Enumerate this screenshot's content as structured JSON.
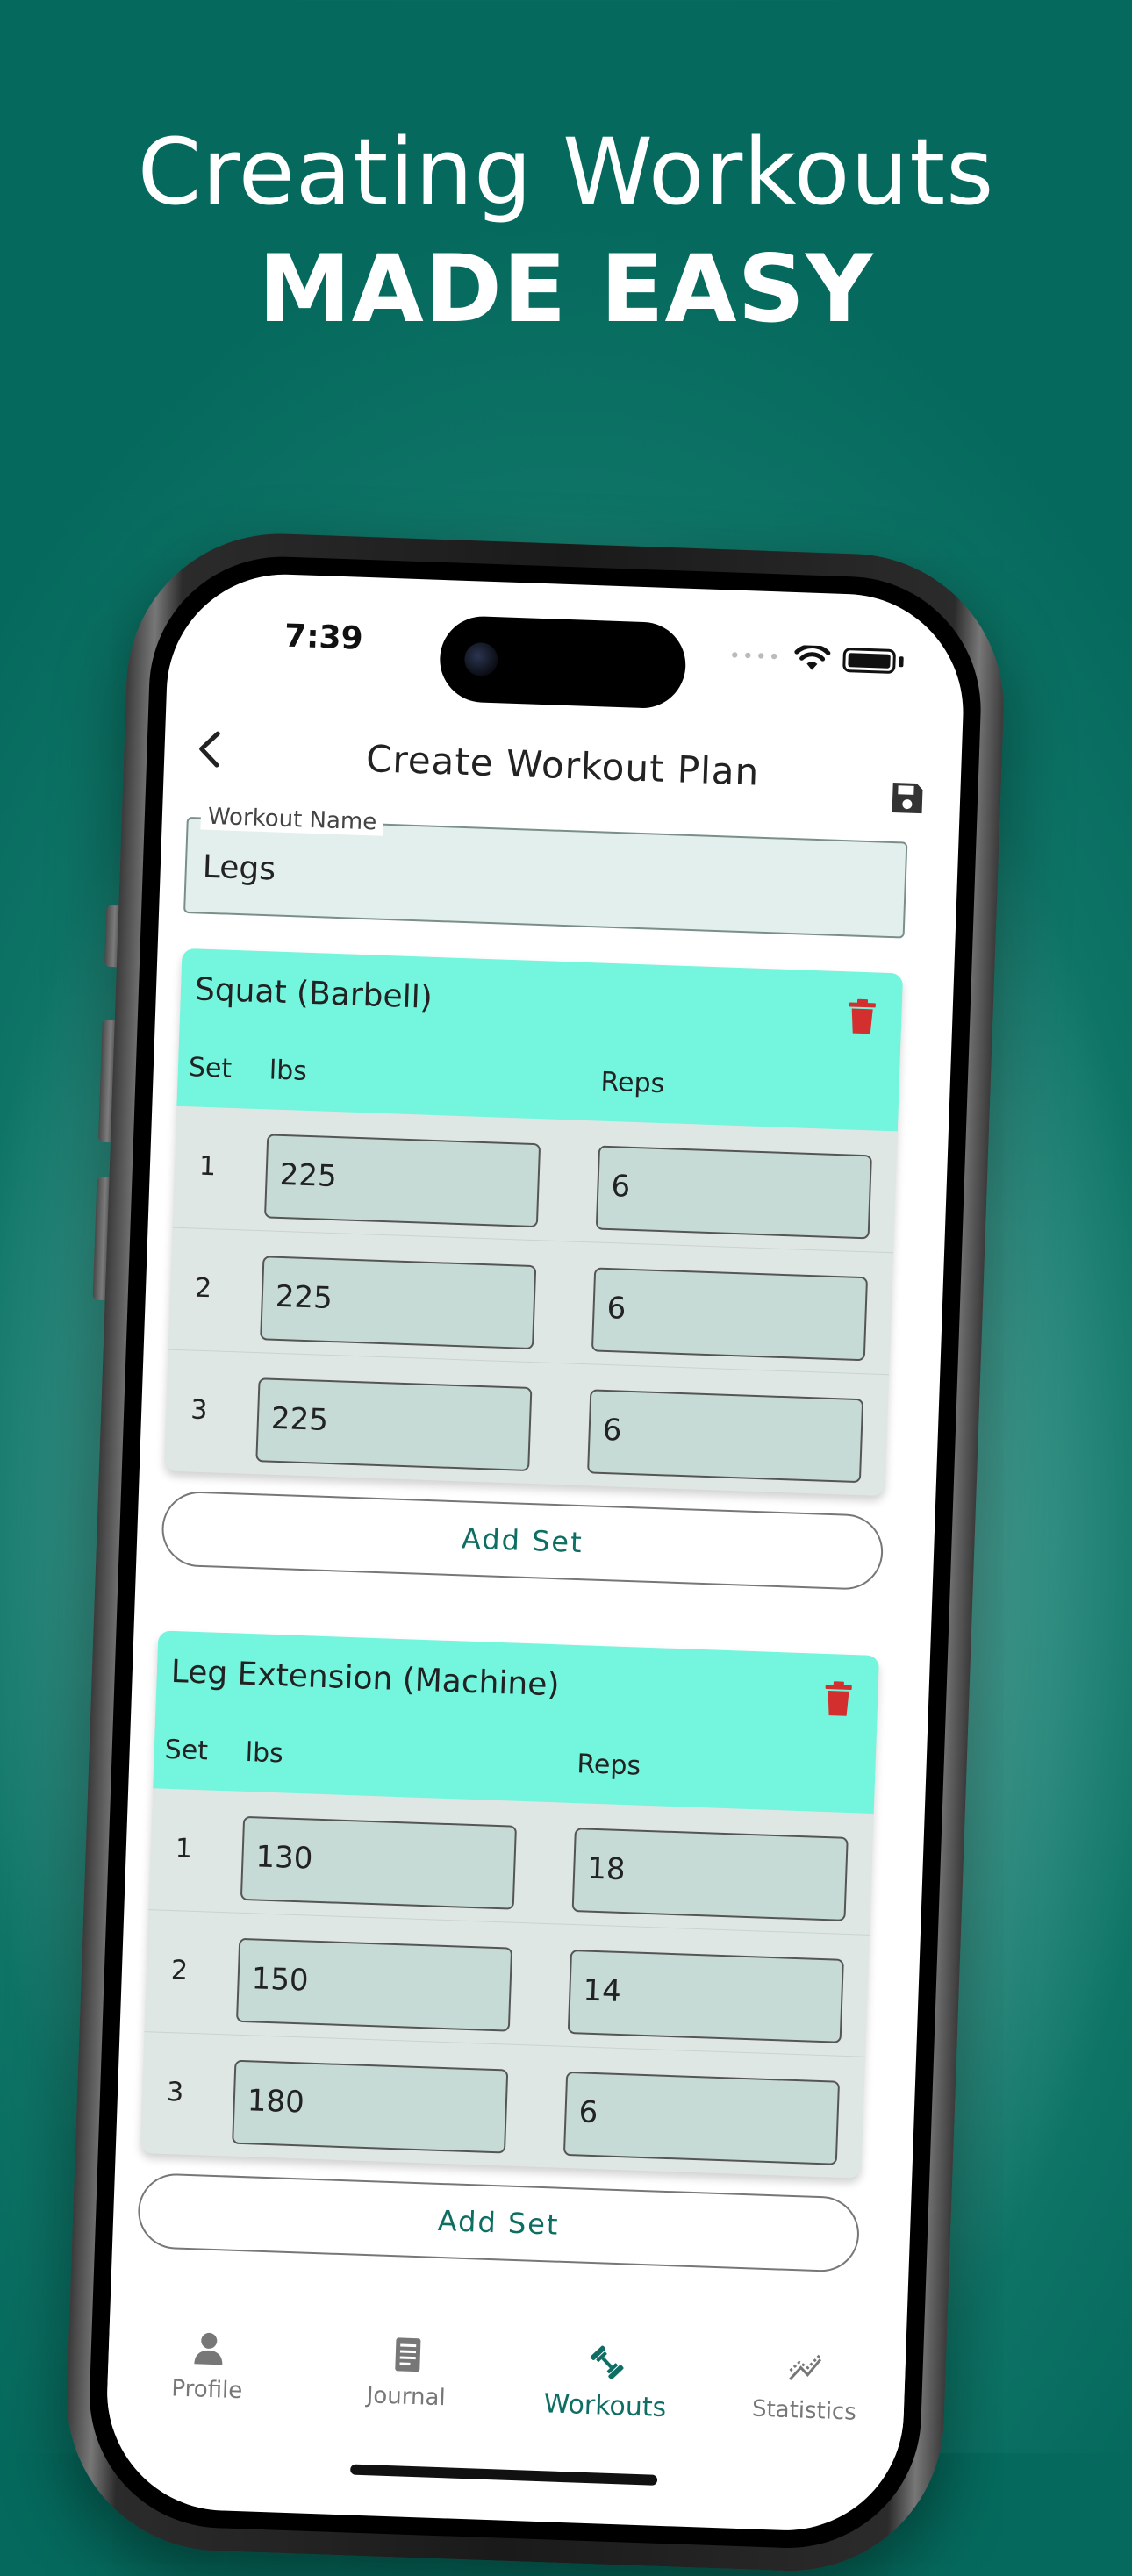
{
  "headline": {
    "line1": "Creating Workouts",
    "line2": "MADE EASY"
  },
  "status_bar": {
    "time": "7:39"
  },
  "app_bar": {
    "title": "Create Workout Plan"
  },
  "workout_name": {
    "label": "Workout Name",
    "value": "Legs"
  },
  "columns": {
    "set": "Set",
    "lbs": "lbs",
    "reps": "Reps"
  },
  "exercises": [
    {
      "name": "Squat (Barbell)",
      "sets": [
        {
          "set": "1",
          "lbs": "225",
          "reps": "6"
        },
        {
          "set": "2",
          "lbs": "225",
          "reps": "6"
        },
        {
          "set": "3",
          "lbs": "225",
          "reps": "6"
        }
      ],
      "add_label": "Add Set"
    },
    {
      "name": "Leg Extension (Machine)",
      "sets": [
        {
          "set": "1",
          "lbs": "130",
          "reps": "18"
        },
        {
          "set": "2",
          "lbs": "150",
          "reps": "14"
        },
        {
          "set": "3",
          "lbs": "180",
          "reps": "6"
        }
      ],
      "add_label": "Add Set"
    }
  ],
  "bottom_nav": {
    "items": [
      {
        "label": "Profile",
        "icon": "person-icon"
      },
      {
        "label": "Journal",
        "icon": "journal-icon"
      },
      {
        "label": "Workouts",
        "icon": "dumbbell-icon"
      },
      {
        "label": "Statistics",
        "icon": "chart-icon"
      }
    ],
    "active": "Workouts"
  },
  "colors": {
    "background": "#0a6e62",
    "accent": "#74f5de",
    "brand": "#0e6e63",
    "delete": "#d32f2f",
    "input_fill": "#c6dbd5"
  }
}
